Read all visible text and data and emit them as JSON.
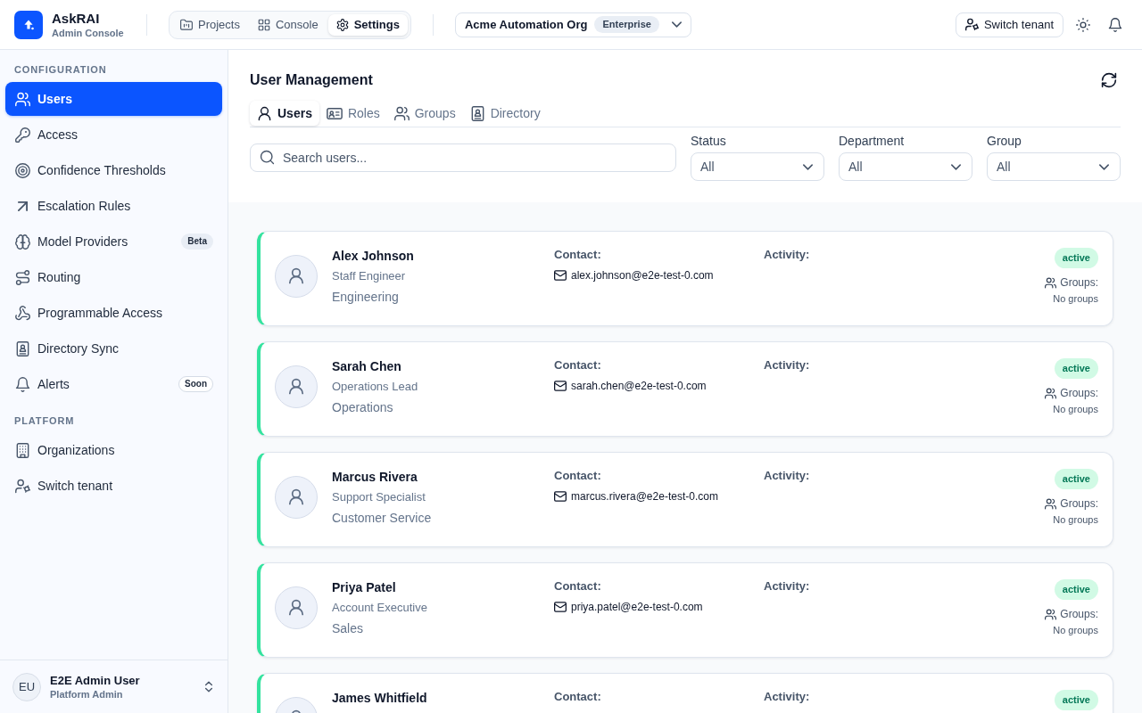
{
  "app": {
    "name": "AskRAI",
    "subtitle": "Admin Console"
  },
  "top_nav": [
    {
      "label": "Projects",
      "selected": false
    },
    {
      "label": "Console",
      "selected": false
    },
    {
      "label": "Settings",
      "selected": true
    }
  ],
  "org_selector": {
    "name": "Acme Automation Org",
    "plan": "Enterprise"
  },
  "header_actions": {
    "switch_tenant": "Switch tenant"
  },
  "sidebar": {
    "sections": [
      {
        "title": "CONFIGURATION",
        "items": [
          {
            "label": "Users",
            "selected": true
          },
          {
            "label": "Access",
            "selected": false
          },
          {
            "label": "Confidence Thresholds",
            "selected": false
          },
          {
            "label": "Escalation Rules",
            "selected": false
          },
          {
            "label": "Model Providers",
            "selected": false,
            "badge": {
              "text": "Beta",
              "kind": "filled"
            }
          },
          {
            "label": "Routing",
            "selected": false
          },
          {
            "label": "Programmable Access",
            "selected": false
          },
          {
            "label": "Directory Sync",
            "selected": false
          },
          {
            "label": "Alerts",
            "selected": false,
            "badge": {
              "text": "Soon",
              "kind": "outline"
            }
          }
        ]
      },
      {
        "title": "PLATFORM",
        "items": [
          {
            "label": "Organizations",
            "selected": false
          },
          {
            "label": "Switch tenant",
            "selected": false
          }
        ]
      }
    ],
    "user": {
      "initials": "EU",
      "name": "E2E Admin User",
      "role": "Platform Admin"
    }
  },
  "page": {
    "title": "User Management",
    "tabs": [
      {
        "label": "Users",
        "selected": true
      },
      {
        "label": "Roles",
        "selected": false
      },
      {
        "label": "Groups",
        "selected": false
      },
      {
        "label": "Directory",
        "selected": false
      }
    ],
    "search": {
      "placeholder": "Search users..."
    },
    "filters": [
      {
        "label": "Status",
        "value": "All"
      },
      {
        "label": "Department",
        "value": "All"
      },
      {
        "label": "Group",
        "value": "All"
      }
    ]
  },
  "users": [
    {
      "name": "Alex Johnson",
      "title": "Staff Engineer",
      "department": "Engineering",
      "contact_label": "Contact:",
      "email": "alex.johnson@e2e-test-0.com",
      "activity_label": "Activity:",
      "status": "active",
      "groups_label": "Groups:",
      "groups": "No groups"
    },
    {
      "name": "Sarah Chen",
      "title": "Operations Lead",
      "department": "Operations",
      "contact_label": "Contact:",
      "email": "sarah.chen@e2e-test-0.com",
      "activity_label": "Activity:",
      "status": "active",
      "groups_label": "Groups:",
      "groups": "No groups"
    },
    {
      "name": "Marcus Rivera",
      "title": "Support Specialist",
      "department": "Customer Service",
      "contact_label": "Contact:",
      "email": "marcus.rivera@e2e-test-0.com",
      "activity_label": "Activity:",
      "status": "active",
      "groups_label": "Groups:",
      "groups": "No groups"
    },
    {
      "name": "Priya Patel",
      "title": "Account Executive",
      "department": "Sales",
      "contact_label": "Contact:",
      "email": "priya.patel@e2e-test-0.com",
      "activity_label": "Activity:",
      "status": "active",
      "groups_label": "Groups:",
      "groups": "No groups"
    },
    {
      "name": "James Whitfield",
      "contact_label": "Contact:",
      "activity_label": "Activity:",
      "status": "active"
    }
  ]
}
